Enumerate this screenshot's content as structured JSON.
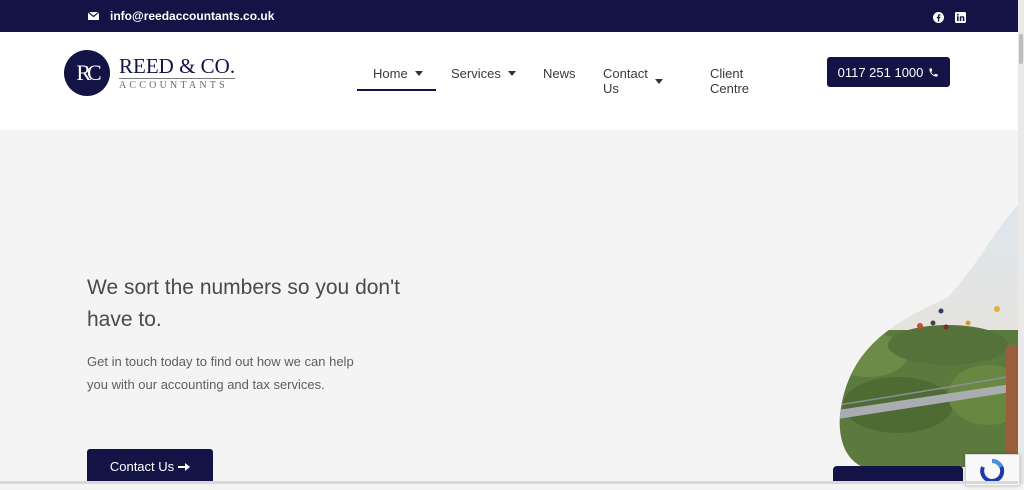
{
  "topbar": {
    "email": "info@reedaccountants.co.uk",
    "mail_icon": "envelope-icon",
    "social": [
      "facebook-icon",
      "linkedin-icon"
    ],
    "bg_color": "#131346"
  },
  "header": {
    "logo": {
      "monogram": "RC",
      "brand": "REED & CO.",
      "sub": "ACCOUNTANTS"
    },
    "nav": [
      {
        "label": "Home",
        "dropdown": true,
        "active": true
      },
      {
        "label": "Services",
        "dropdown": true,
        "active": false
      },
      {
        "label": "News",
        "dropdown": false,
        "active": false
      },
      {
        "label": "Contact Us",
        "dropdown": true,
        "active": false
      },
      {
        "label": "Client Centre",
        "dropdown": false,
        "active": false
      }
    ],
    "phone": "0117 251 1000",
    "phone_icon": "phone-icon"
  },
  "hero": {
    "title": "We sort the numbers so you don't have to.",
    "text": "Get in touch today to find out how we can help you with our accounting and tax services.",
    "cta": "Contact Us",
    "cta_icon": "arrow-right-icon"
  },
  "colors": {
    "accent": "#131346",
    "hero_bg": "#f4f4f4"
  }
}
